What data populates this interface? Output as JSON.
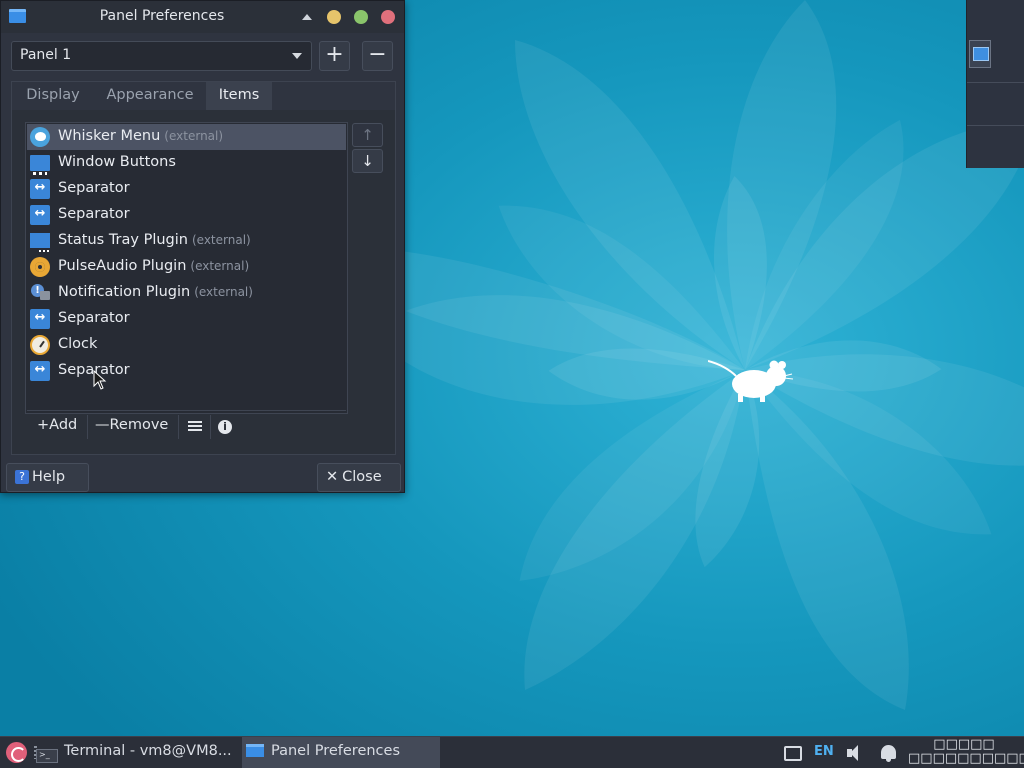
{
  "desktop": {
    "wallpaper_color": "#0f8fb3"
  },
  "dialog": {
    "title": "Panel Preferences",
    "panel_select_value": "Panel 1",
    "add_panel_label": "+",
    "remove_panel_label": "−",
    "tabs": [
      {
        "label": "Display"
      },
      {
        "label": "Appearance"
      },
      {
        "label": "Items"
      }
    ],
    "items": [
      {
        "label": "Whisker Menu",
        "extra": "(external)",
        "icon": "whisker-menu-icon"
      },
      {
        "label": "Window Buttons",
        "extra": "",
        "icon": "window-buttons-icon"
      },
      {
        "label": "Separator",
        "extra": "",
        "icon": "separator-icon"
      },
      {
        "label": "Separator",
        "extra": "",
        "icon": "separator-icon"
      },
      {
        "label": "Status Tray Plugin",
        "extra": "(external)",
        "icon": "status-tray-icon"
      },
      {
        "label": "PulseAudio Plugin",
        "extra": "(external)",
        "icon": "pulseaudio-icon"
      },
      {
        "label": "Notification Plugin",
        "extra": "(external)",
        "icon": "notification-icon"
      },
      {
        "label": "Separator",
        "extra": "",
        "icon": "separator-icon"
      },
      {
        "label": "Clock",
        "extra": "",
        "icon": "clock-icon"
      },
      {
        "label": "Separator",
        "extra": "",
        "icon": "separator-icon"
      }
    ],
    "toolbar": {
      "add_label": "Add",
      "remove_label": "Remove"
    },
    "move_up_label": "↑",
    "move_down_label": "↓",
    "help_label": "Help",
    "close_label": "Close"
  },
  "taskbar": {
    "windows": [
      {
        "label": "Terminal - vm8@VM8..."
      },
      {
        "label": "Panel Preferences"
      }
    ],
    "language": "EN",
    "clock_line1": "□□□□□",
    "clock_line2": "□□□□□□□□□□□"
  },
  "colors": {
    "accent": "#3a86d8",
    "selected_row": "#4c5364",
    "dialog_bg": "#2f3440"
  }
}
